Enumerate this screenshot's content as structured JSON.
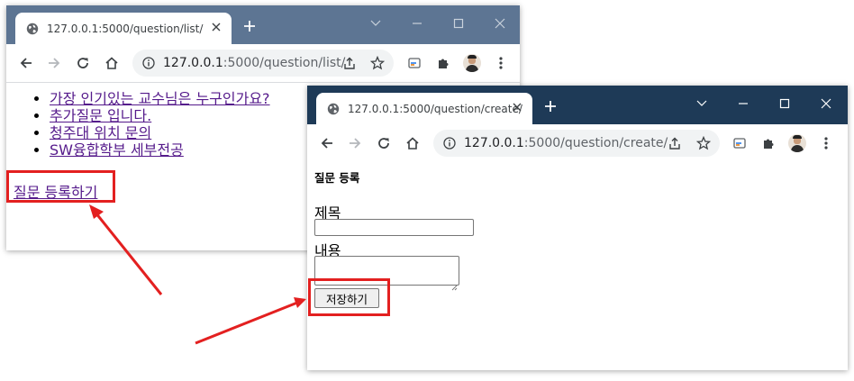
{
  "window_left": {
    "tab_title": "127.0.0.1:5000/question/list/",
    "url_host": "127.0.0.1",
    "url_path": ":5000/question/list/",
    "questions": [
      "가장 인기있는 교수님은 누구인가요?",
      "추가질문 입니다.",
      "청주대 위치 문의",
      "SW융합학부 세부전공"
    ],
    "register_link": "질문 등록하기"
  },
  "window_right": {
    "tab_title": "127.0.0.1:5000/question/create/",
    "url_host": "127.0.0.1",
    "url_path": ":5000/question/create/",
    "form_title": "질문 등록",
    "subject_label": "제목",
    "subject_value": "",
    "content_label": "내용",
    "content_value": "",
    "save_button": "저장하기"
  },
  "colors": {
    "left_tabbar": "#5d7593",
    "right_tabbar": "#1e3a57",
    "link_visited": "#551a8b",
    "highlight_red": "#e32020"
  },
  "icons": [
    "globe-icon",
    "tab-close-icon",
    "new-tab-icon",
    "minimize-icon",
    "maximize-icon",
    "window-close-icon",
    "chevron-down-icon",
    "back-arrow-icon",
    "forward-arrow-icon",
    "reload-icon",
    "home-icon",
    "info-icon",
    "share-icon",
    "star-icon",
    "cast-icon",
    "extensions-icon",
    "avatar",
    "menu-dots-icon"
  ]
}
